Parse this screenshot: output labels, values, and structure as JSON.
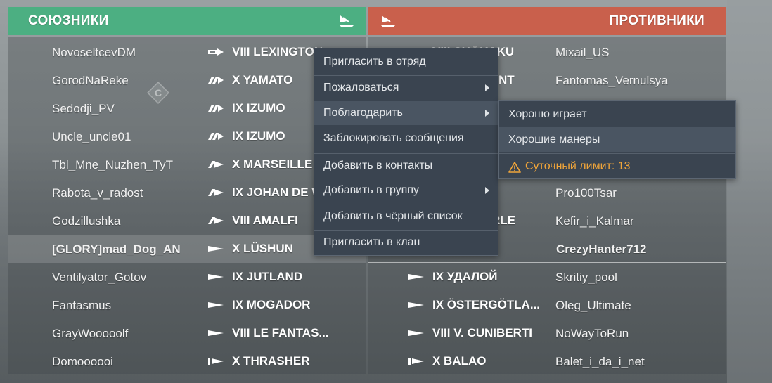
{
  "colors": {
    "allies": "#4caf82",
    "enemies": "#c9604c",
    "menu_bg": "#3a4450",
    "warning": "#f0a53a"
  },
  "allies": {
    "title": "СОЮЗНИКИ",
    "players": [
      {
        "name": "NovoseltcevDM",
        "ship": "VIII LEXINGTON",
        "class": "carrier-icon"
      },
      {
        "name": "GorodNaReke",
        "ship": "X YAMATO",
        "class": "battleship-icon"
      },
      {
        "name": "Sedodji_PV",
        "ship": "IX IZUMO",
        "class": "battleship-icon"
      },
      {
        "name": "Uncle_uncle01",
        "ship": "IX IZUMO",
        "class": "battleship-icon"
      },
      {
        "name": "Tbl_Mne_Nuzhen_TyT",
        "ship": "X MARSEILLE",
        "class": "cruiser-icon"
      },
      {
        "name": "Rabota_v_radost",
        "ship": "IX JOHAN DE WI",
        "class": "cruiser-icon"
      },
      {
        "name": "Godzillushka",
        "ship": "VIII AMALFI",
        "class": "cruiser-icon"
      },
      {
        "name": "[GLORY]mad_Dog_AN",
        "ship": "X LÜSHUN",
        "class": "destroyer-icon"
      },
      {
        "name": "Ventilyator_Gotov",
        "ship": "IX JUTLAND",
        "class": "destroyer-icon"
      },
      {
        "name": "Fantasmus",
        "ship": "IX MOGADOR",
        "class": "destroyer-icon"
      },
      {
        "name": "GrayWooooolf",
        "ship": "VIII LE FANTAS...",
        "class": "destroyer-icon"
      },
      {
        "name": "Domoooooi",
        "ship": "X THRASHER",
        "class": "submarine-icon"
      }
    ],
    "capture_point": "C"
  },
  "enemies": {
    "title": "ПРОТИВНИКИ",
    "players": [
      {
        "name": "Mixail_US",
        "ship": "VIII SHŌKAKU",
        "class": "carrier-icon"
      },
      {
        "name": "Fantomas_Vernulsya",
        "ship": "",
        "class": ""
      },
      {
        "name": "",
        "ship": "",
        "class": ""
      },
      {
        "name": "",
        "ship": "",
        "class": ""
      },
      {
        "name": "",
        "ship": "",
        "class": ""
      },
      {
        "name": "Pro100Tsar",
        "ship": "",
        "class": ""
      },
      {
        "name": "Kefir_i_Kalmar",
        "ship": "",
        "class": ""
      },
      {
        "name": "CrezyHanter712",
        "ship": "",
        "class": ""
      },
      {
        "name": "Skritiy_pool",
        "ship": "IX УДАЛОЙ",
        "class": "destroyer-icon"
      },
      {
        "name": "Oleg_Ultimate",
        "ship": "IX ÖSTERGÖTLA...",
        "class": "destroyer-icon"
      },
      {
        "name": "NoWayToRun",
        "ship": "VIII V. CUNIBERTI",
        "class": "destroyer-icon"
      },
      {
        "name": "Balet_i_da_i_net",
        "ship": "X BALAO",
        "class": "submarine-icon"
      }
    ],
    "partial_visible": {
      "row1_ship_tail": "NT",
      "row6_ship_tail": "RLE"
    }
  },
  "context_menu": {
    "items": [
      {
        "label": "Пригласить в отряд",
        "submenu": false
      },
      {
        "label": "Пожаловаться",
        "submenu": true
      },
      {
        "label": "Поблагодарить",
        "submenu": true
      },
      {
        "label": "Заблокировать сообщения",
        "submenu": false
      },
      {
        "label": "Добавить в контакты",
        "submenu": false
      },
      {
        "label": "Добавить в группу",
        "submenu": true
      },
      {
        "label": "Добавить в чёрный список",
        "submenu": false
      },
      {
        "label": "Пригласить в клан",
        "submenu": false
      }
    ]
  },
  "thank_submenu": {
    "items": [
      {
        "label": "Хорошо играет"
      },
      {
        "label": "Хорошие манеры"
      }
    ],
    "daily_limit": "Суточный лимит: 13"
  }
}
